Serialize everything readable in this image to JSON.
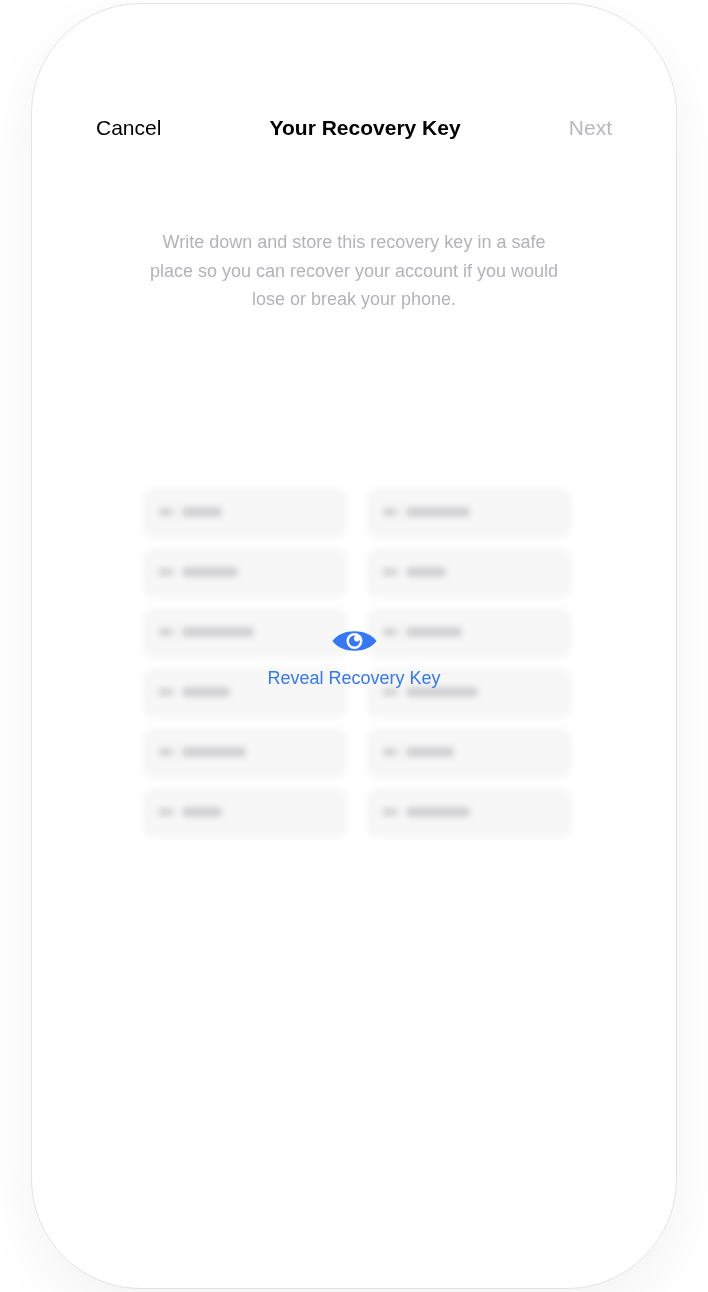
{
  "nav": {
    "cancel": "Cancel",
    "title": "Your Recovery Key",
    "next": {
      "label": "Next",
      "disabled": true
    }
  },
  "description": "Write down and store this recovery key in a safe place so you can recover your account if you would lose or break your phone.",
  "reveal": {
    "label": "Reveal Recovery Key"
  }
}
